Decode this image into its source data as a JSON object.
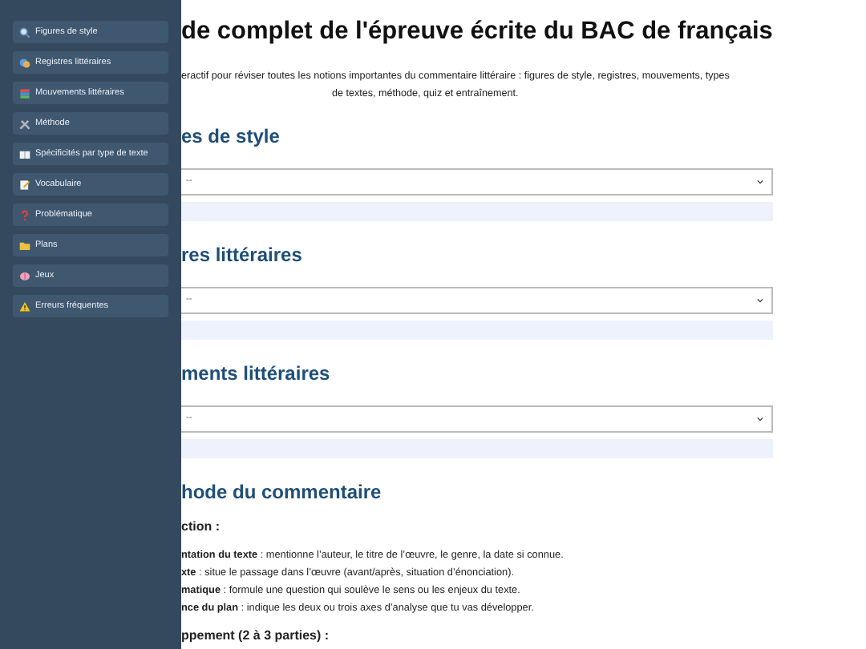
{
  "sidebar": {
    "items": [
      {
        "label": "Figures de style"
      },
      {
        "label": "Registres littéraires"
      },
      {
        "label": "Mouvements littéraires"
      },
      {
        "label": "Méthode"
      },
      {
        "label": "Spécificités par type de texte"
      },
      {
        "label": "Vocabulaire"
      },
      {
        "label": "Problématique"
      },
      {
        "label": "Plans"
      },
      {
        "label": "Jeux"
      },
      {
        "label": "Erreurs fréquentes"
      }
    ]
  },
  "title": "de complet de l'épreuve écrite du BAC de français",
  "intro_lines": [
    "eractif pour réviser toutes les notions importantes du commentaire littéraire : figures de style, registres, mouvements, types",
    "de textes, méthode, quiz et entraînement."
  ],
  "sections": [
    {
      "kind": "select",
      "heading": "es de style",
      "placeholder": "--"
    },
    {
      "kind": "select",
      "heading": "res littéraires",
      "placeholder": "--"
    },
    {
      "kind": "select",
      "heading": "ments littéraires",
      "placeholder": "--"
    },
    {
      "kind": "method",
      "heading": "hode du commentaire",
      "steps": [
        {
          "title": "ction :",
          "points": [
            "**ntation du texte** : mentionne l’auteur, le titre de l’œuvre, le genre, la date si connue.",
            "**xte** : situe le passage dans l’œuvre (avant/après, situation d’énonciation).",
            "**matique** : formule une question qui soulève le sens ou les enjeux du texte.",
            "**nce du plan** : indique les deux ou trois axes d’analyse que tu vas développer."
          ]
        },
        {
          "title": "ppement (2 à 3 parties) :"
        }
      ]
    }
  ]
}
